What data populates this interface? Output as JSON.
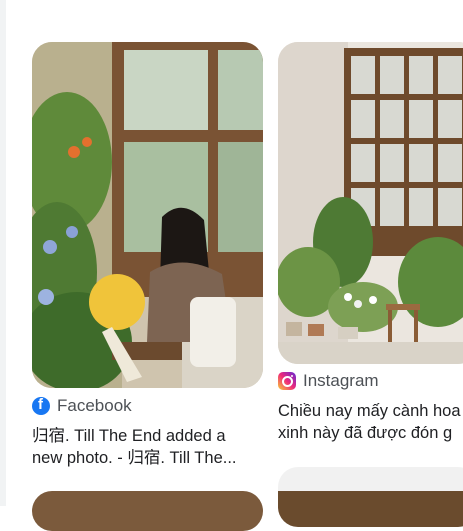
{
  "results": [
    {
      "source": "Facebook",
      "source_icon": "facebook-icon",
      "caption_line1": "归宿. Till The End added a",
      "caption_line2": "new photo. - 归宿. Till The..."
    },
    {
      "source": "Instagram",
      "source_icon": "instagram-icon",
      "caption_line1": "Chiều nay mấy cành hoa",
      "caption_line2": "xinh này đã được đón g"
    }
  ],
  "colors": {
    "facebook": "#1877f2",
    "source_text": "#4d5156",
    "caption_text": "#202124"
  }
}
